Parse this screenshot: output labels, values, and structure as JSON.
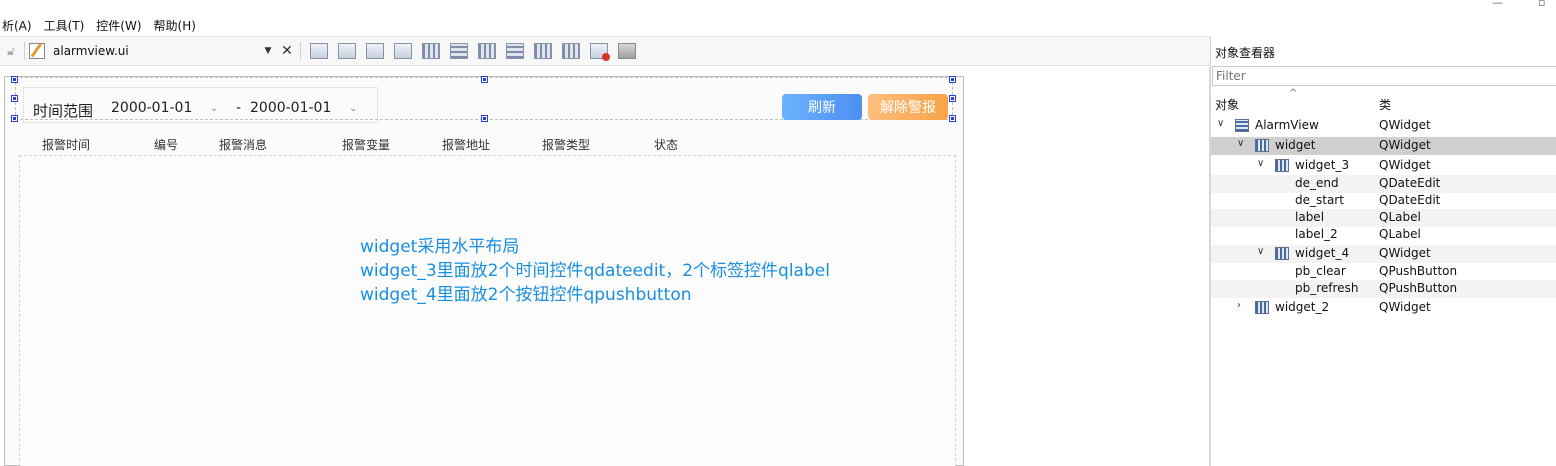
{
  "menu": [
    "析(A)",
    "工具(T)",
    "控件(W)",
    "帮助(H)"
  ],
  "toolbar": {
    "file_name": "alarmview.ui",
    "close_glyph": "✕"
  },
  "form": {
    "time_label": "时间范围",
    "date_start": "2000-01-01",
    "date_end": "2000-01-01",
    "date_separator": "-",
    "refresh_button": "刷新",
    "clear_button": "解除警报",
    "columns": [
      "报警时间",
      "编号",
      "报警消息",
      "报警变量",
      "报警地址",
      "报警类型",
      "状态"
    ],
    "notes": [
      "widget采用水平布局",
      "widget_3里面放2个时间控件qdateedit，2个标签控件qlabel",
      "widget_4里面放2个按钮控件qpushbutton"
    ]
  },
  "inspector": {
    "title": "对象查看器",
    "filter_placeholder": "Filter",
    "col_object": "对象",
    "col_class": "类",
    "rows": [
      {
        "name": "AlarmView",
        "class": "QWidget"
      },
      {
        "name": "widget",
        "class": "QWidget"
      },
      {
        "name": "widget_3",
        "class": "QWidget"
      },
      {
        "name": "de_end",
        "class": "QDateEdit"
      },
      {
        "name": "de_start",
        "class": "QDateEdit"
      },
      {
        "name": "label",
        "class": "QLabel"
      },
      {
        "name": "label_2",
        "class": "QLabel"
      },
      {
        "name": "widget_4",
        "class": "QWidget"
      },
      {
        "name": "pb_clear",
        "class": "QPushButton"
      },
      {
        "name": "pb_refresh",
        "class": "QPushButton"
      },
      {
        "name": "widget_2",
        "class": "QWidget"
      }
    ]
  },
  "colors": {
    "accent_note": "#1a8fe0",
    "refresh": "#5a9df5",
    "clear": "#f9ad5e"
  }
}
